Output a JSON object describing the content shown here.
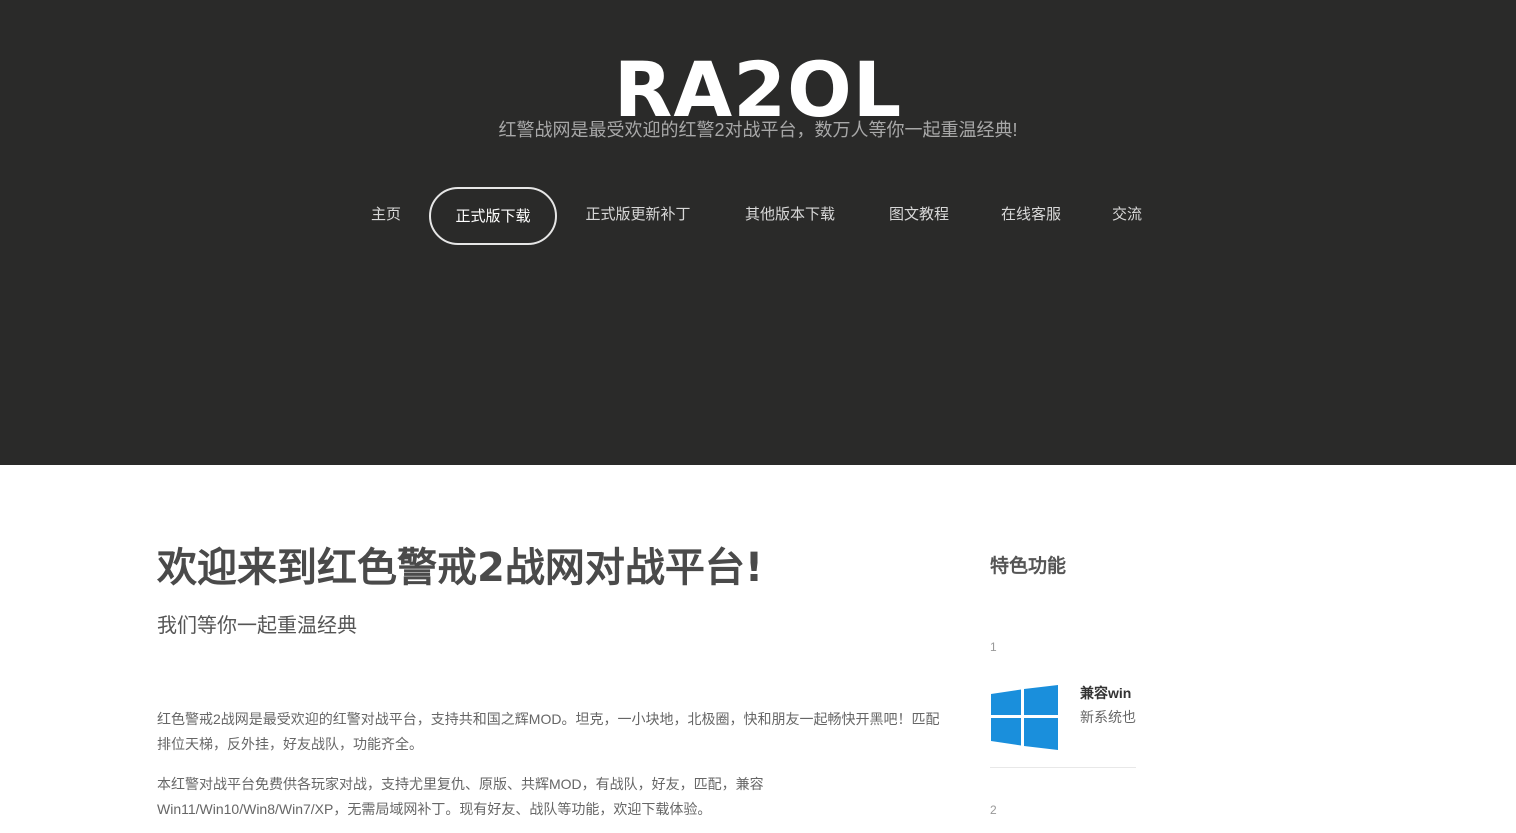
{
  "header": {
    "site_title": "RA2OL",
    "tagline": "红警战网是最受欢迎的红警2对战平台，数万人等你一起重温经典!"
  },
  "nav": {
    "items": [
      {
        "label": "主页"
      },
      {
        "label": "正式版下载"
      },
      {
        "label": "正式版更新补丁"
      },
      {
        "label": "其他版本下载"
      },
      {
        "label": "图文教程"
      },
      {
        "label": "在线客服"
      },
      {
        "label": "交流"
      }
    ],
    "active_index": 1
  },
  "main": {
    "title": "欢迎来到红色警戒2战网对战平台!",
    "subtitle": "我们等你一起重温经典",
    "paragraphs": [
      "红色警戒2战网是最受欢迎的红警对战平台，支持共和国之辉MOD。坦克，一小块地，北极圈，快和朋友一起畅快开黑吧！匹配排位天梯，反外挂，好友战队，功能齐全。",
      "本红警对战平台免费供各玩家对战，支持尤里复仇、原版、共辉MOD，有战队，好友，匹配，兼容Win11/Win10/Win8/Win7/XP，无需局域网补丁。现有好友、战队等功能，欢迎下载体验。"
    ]
  },
  "sidebar": {
    "title": "特色功能",
    "features": [
      {
        "number": "1",
        "heading": "兼容win",
        "description": "新系统也",
        "icon": "windows-logo-icon"
      },
      {
        "number": "2"
      }
    ]
  },
  "colors": {
    "header_bg": "#2a2a29",
    "windows_blue": "#1a8fdc",
    "page_bg": "#ffffff"
  }
}
